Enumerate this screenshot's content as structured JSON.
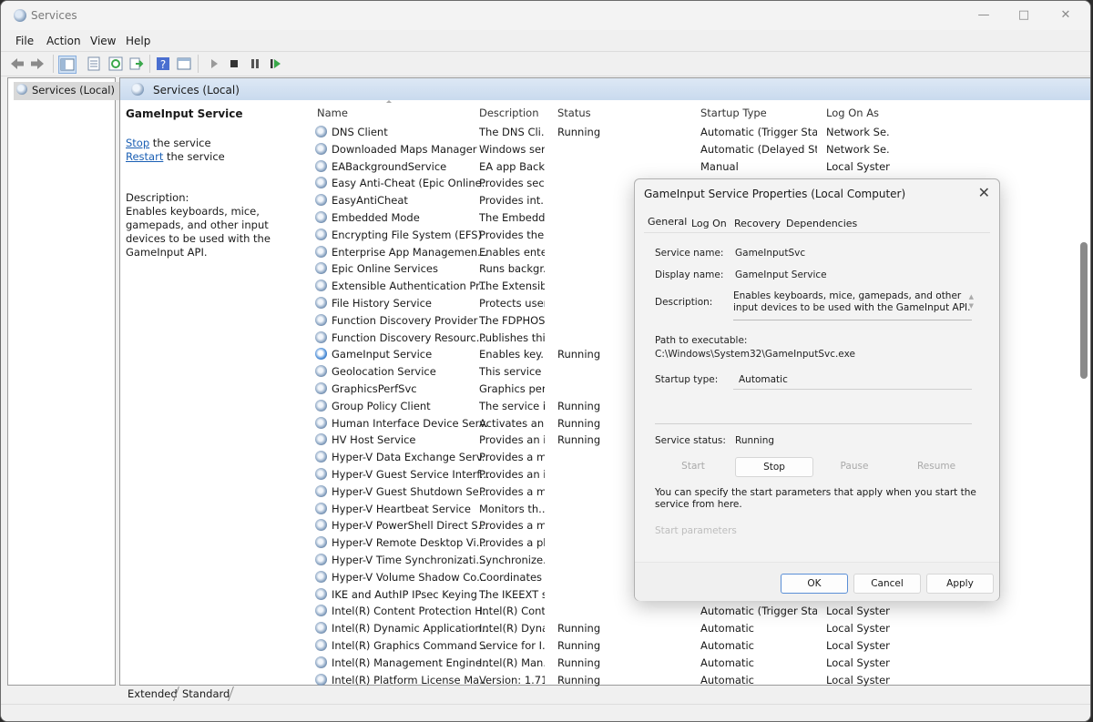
{
  "window": {
    "title": "Services"
  },
  "menu": [
    "File",
    "Action",
    "View",
    "Help"
  ],
  "tree": {
    "root": "Services (Local)"
  },
  "pane_header": "Services (Local)",
  "left_panel": {
    "service_name": "GameInput Service",
    "stop_link": "Stop",
    "stop_rest": " the service",
    "restart_link": "Restart",
    "restart_rest": " the service",
    "description_label": "Description:",
    "description": "Enables keyboards, mice, gamepads, and other input devices to be used with the GameInput API."
  },
  "columns": [
    "Name",
    "Description",
    "Status",
    "Startup Type",
    "Log On As"
  ],
  "services": [
    {
      "name": "DNS Client",
      "desc": "The DNS Cli...",
      "status": "Running",
      "startup": "Automatic (Trigger Start)",
      "logon": "Network Se..."
    },
    {
      "name": "Downloaded Maps Manager",
      "desc": "Windows ser...",
      "status": "",
      "startup": "Automatic (Delayed Sta...",
      "logon": "Network Se..."
    },
    {
      "name": "EABackgroundService",
      "desc": "EA app Back...",
      "status": "",
      "startup": "Manual",
      "logon": "Local System"
    },
    {
      "name": "Easy Anti-Cheat (Epic Online...",
      "desc": "Provides sec...",
      "status": "",
      "startup": "",
      "logon": ""
    },
    {
      "name": "EasyAntiCheat",
      "desc": "Provides int...",
      "status": "",
      "startup": "",
      "logon": ""
    },
    {
      "name": "Embedded Mode",
      "desc": "The Embedd...",
      "status": "",
      "startup": "",
      "logon": ""
    },
    {
      "name": "Encrypting File System (EFS)",
      "desc": "Provides the...",
      "status": "",
      "startup": "",
      "logon": ""
    },
    {
      "name": "Enterprise App Managemen...",
      "desc": "Enables ente...",
      "status": "",
      "startup": "",
      "logon": ""
    },
    {
      "name": "Epic Online Services",
      "desc": "Runs backgr...",
      "status": "",
      "startup": "",
      "logon": ""
    },
    {
      "name": "Extensible Authentication Pr...",
      "desc": "The Extensib...",
      "status": "",
      "startup": "",
      "logon": ""
    },
    {
      "name": "File History Service",
      "desc": "Protects user...",
      "status": "",
      "startup": "",
      "logon": ""
    },
    {
      "name": "Function Discovery Provider ...",
      "desc": "The FDPHOS...",
      "status": "",
      "startup": "",
      "logon": ""
    },
    {
      "name": "Function Discovery Resourc...",
      "desc": "Publishes thi...",
      "status": "",
      "startup": "",
      "logon": ""
    },
    {
      "name": "GameInput Service",
      "desc": "Enables key...",
      "status": "Running",
      "startup": "",
      "logon": "",
      "selected": true
    },
    {
      "name": "Geolocation Service",
      "desc": "This service ...",
      "status": "",
      "startup": "",
      "logon": ""
    },
    {
      "name": "GraphicsPerfSvc",
      "desc": "Graphics per...",
      "status": "",
      "startup": "",
      "logon": ""
    },
    {
      "name": "Group Policy Client",
      "desc": "The service i...",
      "status": "Running",
      "startup": "",
      "logon": ""
    },
    {
      "name": "Human Interface Device Serv...",
      "desc": "Activates an...",
      "status": "Running",
      "startup": "",
      "logon": ""
    },
    {
      "name": "HV Host Service",
      "desc": "Provides an i...",
      "status": "Running",
      "startup": "",
      "logon": ""
    },
    {
      "name": "Hyper-V Data Exchange Serv...",
      "desc": "Provides a m...",
      "status": "",
      "startup": "",
      "logon": ""
    },
    {
      "name": "Hyper-V Guest Service Interf...",
      "desc": "Provides an i...",
      "status": "",
      "startup": "",
      "logon": ""
    },
    {
      "name": "Hyper-V Guest Shutdown Se...",
      "desc": "Provides a m...",
      "status": "",
      "startup": "",
      "logon": ""
    },
    {
      "name": "Hyper-V Heartbeat Service",
      "desc": "Monitors th...",
      "status": "",
      "startup": "",
      "logon": ""
    },
    {
      "name": "Hyper-V PowerShell Direct S...",
      "desc": "Provides a m...",
      "status": "",
      "startup": "",
      "logon": ""
    },
    {
      "name": "Hyper-V Remote Desktop Vi...",
      "desc": "Provides a pl...",
      "status": "",
      "startup": "",
      "logon": ""
    },
    {
      "name": "Hyper-V Time Synchronizati...",
      "desc": "Synchronize...",
      "status": "",
      "startup": "",
      "logon": ""
    },
    {
      "name": "Hyper-V Volume Shadow Co...",
      "desc": "Coordinates ...",
      "status": "",
      "startup": "",
      "logon": ""
    },
    {
      "name": "IKE and AuthIP IPsec Keying ...",
      "desc": "The IKEEXT s...",
      "status": "",
      "startup": "",
      "logon": ""
    },
    {
      "name": "Intel(R) Content Protection H...",
      "desc": "Intel(R) Cont...",
      "status": "",
      "startup": "Automatic (Trigger Start)",
      "logon": "Local System"
    },
    {
      "name": "Intel(R) Dynamic Application...",
      "desc": "Intel(R) Dyna...",
      "status": "Running",
      "startup": "Automatic",
      "logon": "Local System"
    },
    {
      "name": "Intel(R) Graphics Command ...",
      "desc": "Service for I...",
      "status": "Running",
      "startup": "Automatic",
      "logon": "Local System"
    },
    {
      "name": "Intel(R) Management Engine...",
      "desc": "Intel(R) Man...",
      "status": "Running",
      "startup": "Automatic",
      "logon": "Local System"
    },
    {
      "name": "Intel(R) Platform License Ma...",
      "desc": "Version: 1.71...",
      "status": "Running",
      "startup": "Automatic",
      "logon": "Local System"
    }
  ],
  "bottom_tabs": [
    "Extended",
    "Standard"
  ],
  "dialog": {
    "title": "GameInput Service Properties (Local Computer)",
    "tabs": [
      "General",
      "Log On",
      "Recovery",
      "Dependencies"
    ],
    "service_name_label": "Service name:",
    "service_name": "GameInputSvc",
    "display_name_label": "Display name:",
    "display_name": "GameInput Service",
    "description_label": "Description:",
    "description": "Enables keyboards, mice, gamepads, and other input devices to be used with the GameInput API.",
    "path_label": "Path to executable:",
    "path": "C:\\Windows\\System32\\GameInputSvc.exe",
    "startup_type_label": "Startup type:",
    "startup_type": "Automatic",
    "service_status_label": "Service status:",
    "service_status": "Running",
    "buttons": {
      "start": "Start",
      "stop": "Stop",
      "pause": "Pause",
      "resume": "Resume"
    },
    "help_text": "You can specify the start parameters that apply when you start the service from here.",
    "start_params_label": "Start parameters",
    "footer": {
      "ok": "OK",
      "cancel": "Cancel",
      "apply": "Apply"
    }
  }
}
